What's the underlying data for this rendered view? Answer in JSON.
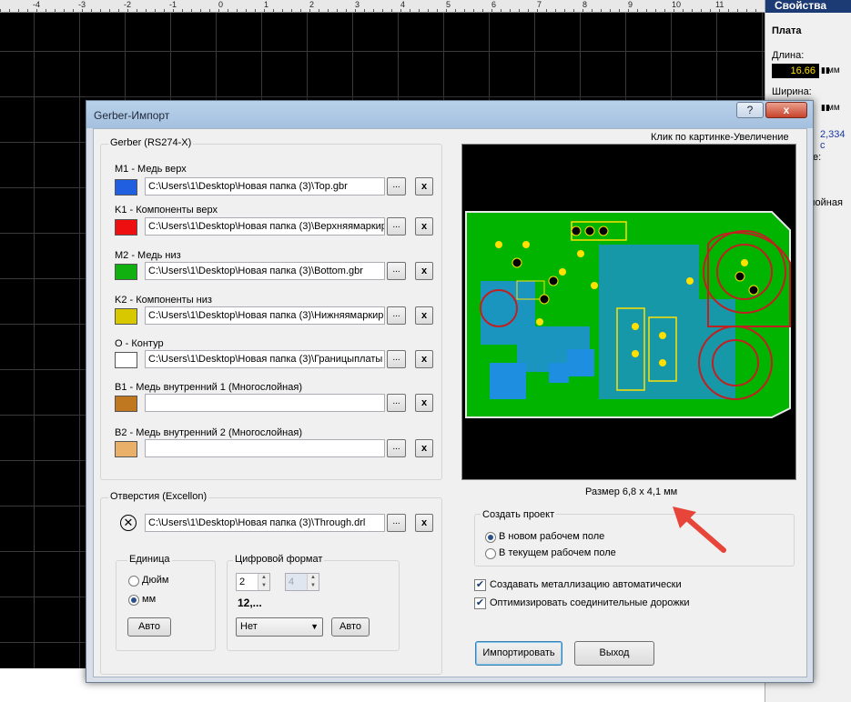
{
  "ruler": {
    "ticks": [
      "-4",
      "-3",
      "-2",
      "-1",
      "0",
      "1",
      "2",
      "3",
      "4",
      "5",
      "6",
      "7",
      "8",
      "9",
      "10",
      "11"
    ]
  },
  "props": {
    "title": "Свойства",
    "section": "Плата",
    "length_label": "Длина:",
    "length_value": "16.66",
    "length_unit": "мм",
    "width_label": "Ширина:",
    "width_unit": "мм",
    "partial_value": "2,334 с",
    "partial_label_1": "е:",
    "partial_label_2": "лойная"
  },
  "dialog": {
    "title": "Gerber-Импорт",
    "help_label": "?",
    "close_label": "x",
    "gerber_group": "Gerber (RS274-X)",
    "browse_label": "...",
    "clear_label": "x",
    "layers": [
      {
        "label": "M1 - Медь верх",
        "path": "C:\\Users\\1\\Desktop\\Новая папка (3)\\Top.gbr",
        "color": "#1f5fe0"
      },
      {
        "label": "K1 - Компоненты верх",
        "path": "C:\\Users\\1\\Desktop\\Новая папка (3)\\Верхняямаркир",
        "color": "#ee1010"
      },
      {
        "label": "M2 - Медь низ",
        "path": "C:\\Users\\1\\Desktop\\Новая папка (3)\\Bottom.gbr",
        "color": "#10b010"
      },
      {
        "label": "K2 - Компоненты низ",
        "path": "C:\\Users\\1\\Desktop\\Новая папка (3)\\Нижняямаркир",
        "color": "#d8c800"
      },
      {
        "label": "O - Контур",
        "path": "C:\\Users\\1\\Desktop\\Новая папка (3)\\Границыплаты",
        "color": "#ffffff"
      },
      {
        "label": "B1 - Медь внутренний 1 (Многослойная)",
        "path": "",
        "color": "#c07820"
      },
      {
        "label": "B2 - Медь внутренний 2 (Многослойная)",
        "path": "",
        "color": "#e8b068"
      }
    ],
    "drill_group": "Отверстия (Excellon)",
    "drill_path": "C:\\Users\\1\\Desktop\\Новая папка (3)\\Through.drl",
    "unit_group": "Единица",
    "unit_inch": "Дюйм",
    "unit_mm": "мм",
    "auto_label": "Авто",
    "format_group": "Цифровой формат",
    "format_int": "2",
    "format_dec": "4",
    "format_preview": "12,...",
    "zero_select": "Нет",
    "preview_hint": "Клик по картинке-Увеличение",
    "size_text": "Размер 6,8 x 4,1 мм",
    "project_group": "Создать проект",
    "project_new": "В новом рабочем поле",
    "project_current": "В текущем рабочем поле",
    "check_metal": "Создавать металлизацию автоматически",
    "check_optimize": "Оптимизировать соединительные дорожки",
    "import_label": "Импортировать",
    "exit_label": "Выход"
  }
}
